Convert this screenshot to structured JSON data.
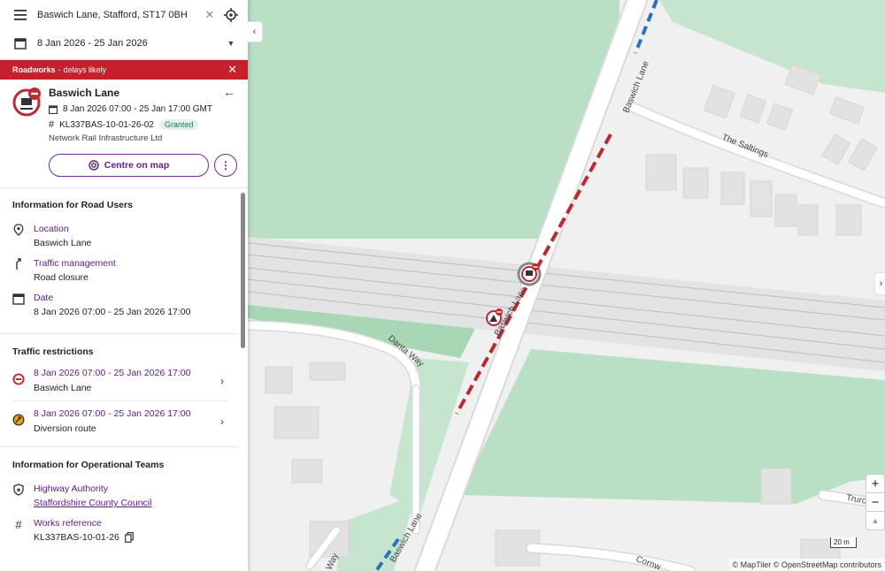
{
  "search": {
    "location_value": "Baswich Lane, Stafford, ST17 0BH",
    "date_range": "8 Jan 2026 - 25 Jan 2026"
  },
  "banner": {
    "title": "Roadworks",
    "subtitle": "delays likely"
  },
  "works": {
    "title": "Baswich Lane",
    "dates": "8 Jan 2026 07:00 - 25 Jan 17:00 GMT",
    "reference": "KL337BAS-10-01-26-02",
    "status": "Granted",
    "promoter": "Network Rail Infrastructure Ltd",
    "centre_button": "Centre on map",
    "more_button": "⋮"
  },
  "road_users": {
    "heading": "Information for Road Users",
    "items": [
      {
        "label": "Location",
        "value": "Baswich Lane",
        "icon": "location-pin-icon"
      },
      {
        "label": "Traffic management",
        "value": "Road closure",
        "icon": "traffic-management-icon"
      },
      {
        "label": "Date",
        "value": "8 Jan 2026 07:00 - 25 Jan 2026 17:00",
        "icon": "calendar-icon"
      }
    ]
  },
  "restrictions": {
    "heading": "Traffic restrictions",
    "items": [
      {
        "dates": "8 Jan 2026 07:00 - 25 Jan 2026 17:00",
        "name": "Baswich Lane",
        "icon": "no-entry-icon"
      },
      {
        "dates": "8 Jan 2026 07:00 - 25 Jan 2026 17:00",
        "name": "Diversion route",
        "icon": "diversion-icon"
      }
    ]
  },
  "operational": {
    "heading": "Information for Operational Teams",
    "highway_authority_label": "Highway Authority",
    "highway_authority_value": "Staffordshire County Council",
    "works_reference_label": "Works reference",
    "works_reference_value": "KL337BAS-10-01-26"
  },
  "map": {
    "labels": {
      "baswich_lane_north": "Baswich Lane",
      "baswich_lane_centre": "Baswich Lane",
      "baswich_lane_south": "Baswich Lane",
      "the_saltings": "The Saltings",
      "danta_way": "Danta Way",
      "way": "Way",
      "cornw": "Cornw",
      "truro": "Truro"
    },
    "zoom_in": "+",
    "zoom_out": "−",
    "compass": "▲",
    "scale": "20 m",
    "attribution": "© MapTiler © OpenStreetMap contributors"
  },
  "colors": {
    "accent": "#5a2184",
    "banner": "#c5202c",
    "granted_bg": "#dff3ea",
    "park": "#b9dfc4",
    "closure": "#c0282f"
  }
}
